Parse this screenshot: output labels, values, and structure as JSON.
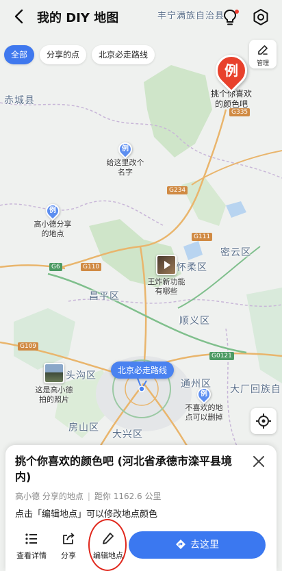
{
  "header": {
    "title": "我的 DIY 地图"
  },
  "filters": [
    {
      "label": "全部",
      "active": true
    },
    {
      "label": "分享的点",
      "active": false
    },
    {
      "label": "北京必走路线",
      "active": false
    }
  ],
  "manage": {
    "label": "管理"
  },
  "map": {
    "places": {
      "fengning": "丰宁满族自治县",
      "chicheng": "赤城县",
      "huairou": "怀柔区",
      "miyun": "密云区",
      "changping": "昌平区",
      "shunyi": "顺义区",
      "mentougou": "头沟区",
      "tongzhou": "通州区",
      "dachang": "大厂回族自",
      "fangshan": "房山区",
      "daxing": "大兴区"
    },
    "roads": {
      "g335": "G335",
      "g234": "G234",
      "g111": "G111",
      "g6": "G6",
      "g110": "G110",
      "g109": "G109",
      "g0121": "G0121"
    },
    "pins": {
      "big_marker": "例",
      "marker": "例",
      "favorite_color": "挑个你喜欢\n的颜色吧",
      "rename": "给这里改个\n名字",
      "shared": "高小德分享\n的地点",
      "new_feature": "王炸新功能\n有哪些",
      "photo": "这是高小德\n拍的照片",
      "deletable": "不喜欢的地\n点可以删掉"
    },
    "route_chip": "北京必走路线"
  },
  "card": {
    "title": "挑个你喜欢的颜色吧 (河北省承德市滦平县境内)",
    "source": "高小德 分享的地点",
    "separator": "|",
    "distance": "距你 1162.6 公里",
    "hint": "点击「编辑地点」可以修改地点颜色",
    "actions": {
      "details": "查看详情",
      "share": "分享",
      "edit": "编辑地点",
      "go": "去这里"
    }
  },
  "colors": {
    "accent": "#3b78f0",
    "big_pin": "#e8412c",
    "small_pin": "#5c8ef0",
    "highlight": "#e0261b"
  }
}
